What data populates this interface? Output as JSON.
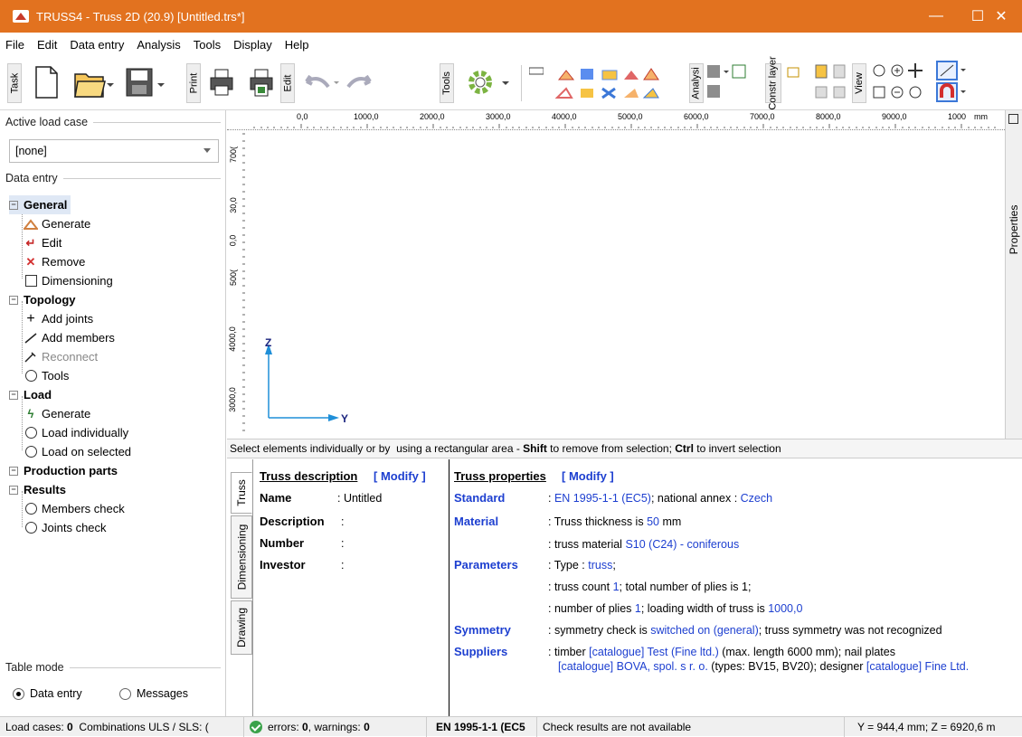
{
  "window": {
    "title": "TRUSS4 - Truss 2D  (20.9)  [Untitled.trs*]",
    "minimize": "—",
    "maximize": "☐",
    "close": "✕"
  },
  "menu": [
    "File",
    "Edit",
    "Data entry",
    "Analysis",
    "Tools",
    "Display",
    "Help"
  ],
  "toolbar": {
    "task_label": "Task",
    "print_label": "Print",
    "edit_label": "Edit",
    "tools_label": "Tools",
    "analysis_label": "Analysi",
    "construction_label": "Constr layer",
    "view_label": "View"
  },
  "left": {
    "active_load_case_header": "Active load case",
    "active_load_case_value": "[none]",
    "data_entry_header": "Data entry",
    "tree": {
      "general": "General",
      "generate": "Generate",
      "edit": "Edit",
      "remove": "Remove",
      "dimensioning": "Dimensioning",
      "topology": "Topology",
      "add_joints": "Add joints",
      "add_members": "Add members",
      "reconnect": "Reconnect",
      "tools": "Tools",
      "load": "Load",
      "load_generate": "Generate",
      "load_individually": "Load individually",
      "load_on_selected": "Load on selected",
      "production_parts": "Production parts",
      "results": "Results",
      "members_check": "Members check",
      "joints_check": "Joints check"
    },
    "table_mode_header": "Table mode",
    "table_mode_options": [
      "Data entry",
      "Messages"
    ],
    "table_mode_selected": "Data entry"
  },
  "canvas": {
    "hruler": [
      "0,0",
      "1000,0",
      "2000,0",
      "3000,0",
      "4000,0",
      "5000,0",
      "6000,0",
      "7000,0",
      "8000,0",
      "9000,0",
      "1000",
      "mm"
    ],
    "vruler": [
      "700(",
      "30,0",
      "0,0",
      "500(",
      "4000,0",
      "3000,0"
    ],
    "axis_z": "Z",
    "axis_y": "Y",
    "properties_tab": "Properties"
  },
  "status_message": {
    "pre": "Select elements individually or by  using a rectangular area - ",
    "shift": "Shift",
    "mid": " to remove from selection; ",
    "ctrl": "Ctrl",
    "post": " to invert selection"
  },
  "bottom": {
    "tabs": [
      "Truss",
      "Dimensioning",
      "Drawing"
    ],
    "desc": {
      "header": "Truss description",
      "modify": "[ Modify ]",
      "name_label": "Name",
      "name_value": ": Untitled",
      "description_label": "Description",
      "description_value": ":",
      "number_label": "Number",
      "number_value": ":",
      "investor_label": "Investor",
      "investor_value": ":"
    },
    "props": {
      "header": "Truss properties",
      "modify": "[ Modify ]",
      "standard_label": "Standard",
      "standard_colon": ": ",
      "standard_value": "EN 1995-1-1 (EC5)",
      "standard_mid": "; national annex : ",
      "standard_annex": "Czech",
      "material_label": "Material",
      "material_1_pre": ": Truss thickness is ",
      "material_1_val": "50",
      "material_1_post": " mm",
      "material_2_pre": ": truss material ",
      "material_2_val": "S10 (C24) - coniferous",
      "parameters_label": "Parameters",
      "param_1_pre": ": Type : ",
      "param_1_val": "truss",
      "param_1_post": ";",
      "param_2_pre": ": truss count ",
      "param_2_val": "1",
      "param_2_post": "; total number of plies is 1;",
      "param_3_pre": ": number of plies ",
      "param_3_val": "1",
      "param_3_mid": "; loading width of truss is ",
      "param_3_val2": "1000,0",
      "symmetry_label": "Symmetry",
      "sym_pre": ": symmetry check is ",
      "sym_val": "switched on (general)",
      "sym_post": "; truss symmetry was not recognized",
      "suppliers_label": "Suppliers",
      "sup_1_pre": ": timber ",
      "sup_1_val": "[catalogue] Test (Fine ltd.)",
      "sup_1_post": " (max. length 6000 mm); nail plates",
      "sup_2_val": "[catalogue] BOVA, spol. s r. o.",
      "sup_2_mid": " (types: BV15, BV20); designer ",
      "sup_2_val2": "[catalogue] Fine Ltd."
    }
  },
  "statusbar": {
    "load_cases_label": "Load cases: ",
    "load_cases_value": "0",
    "combinations": "  Combinations ULS / SLS: (",
    "errors_label": "errors: ",
    "errors_value": "0",
    "warnings_label": ", warnings: ",
    "warnings_value": "0",
    "standard": "EN 1995-1-1 (EC5",
    "check": "Check results are not available",
    "coords": "Y = 944,4 mm; Z = 6920,6 m"
  }
}
